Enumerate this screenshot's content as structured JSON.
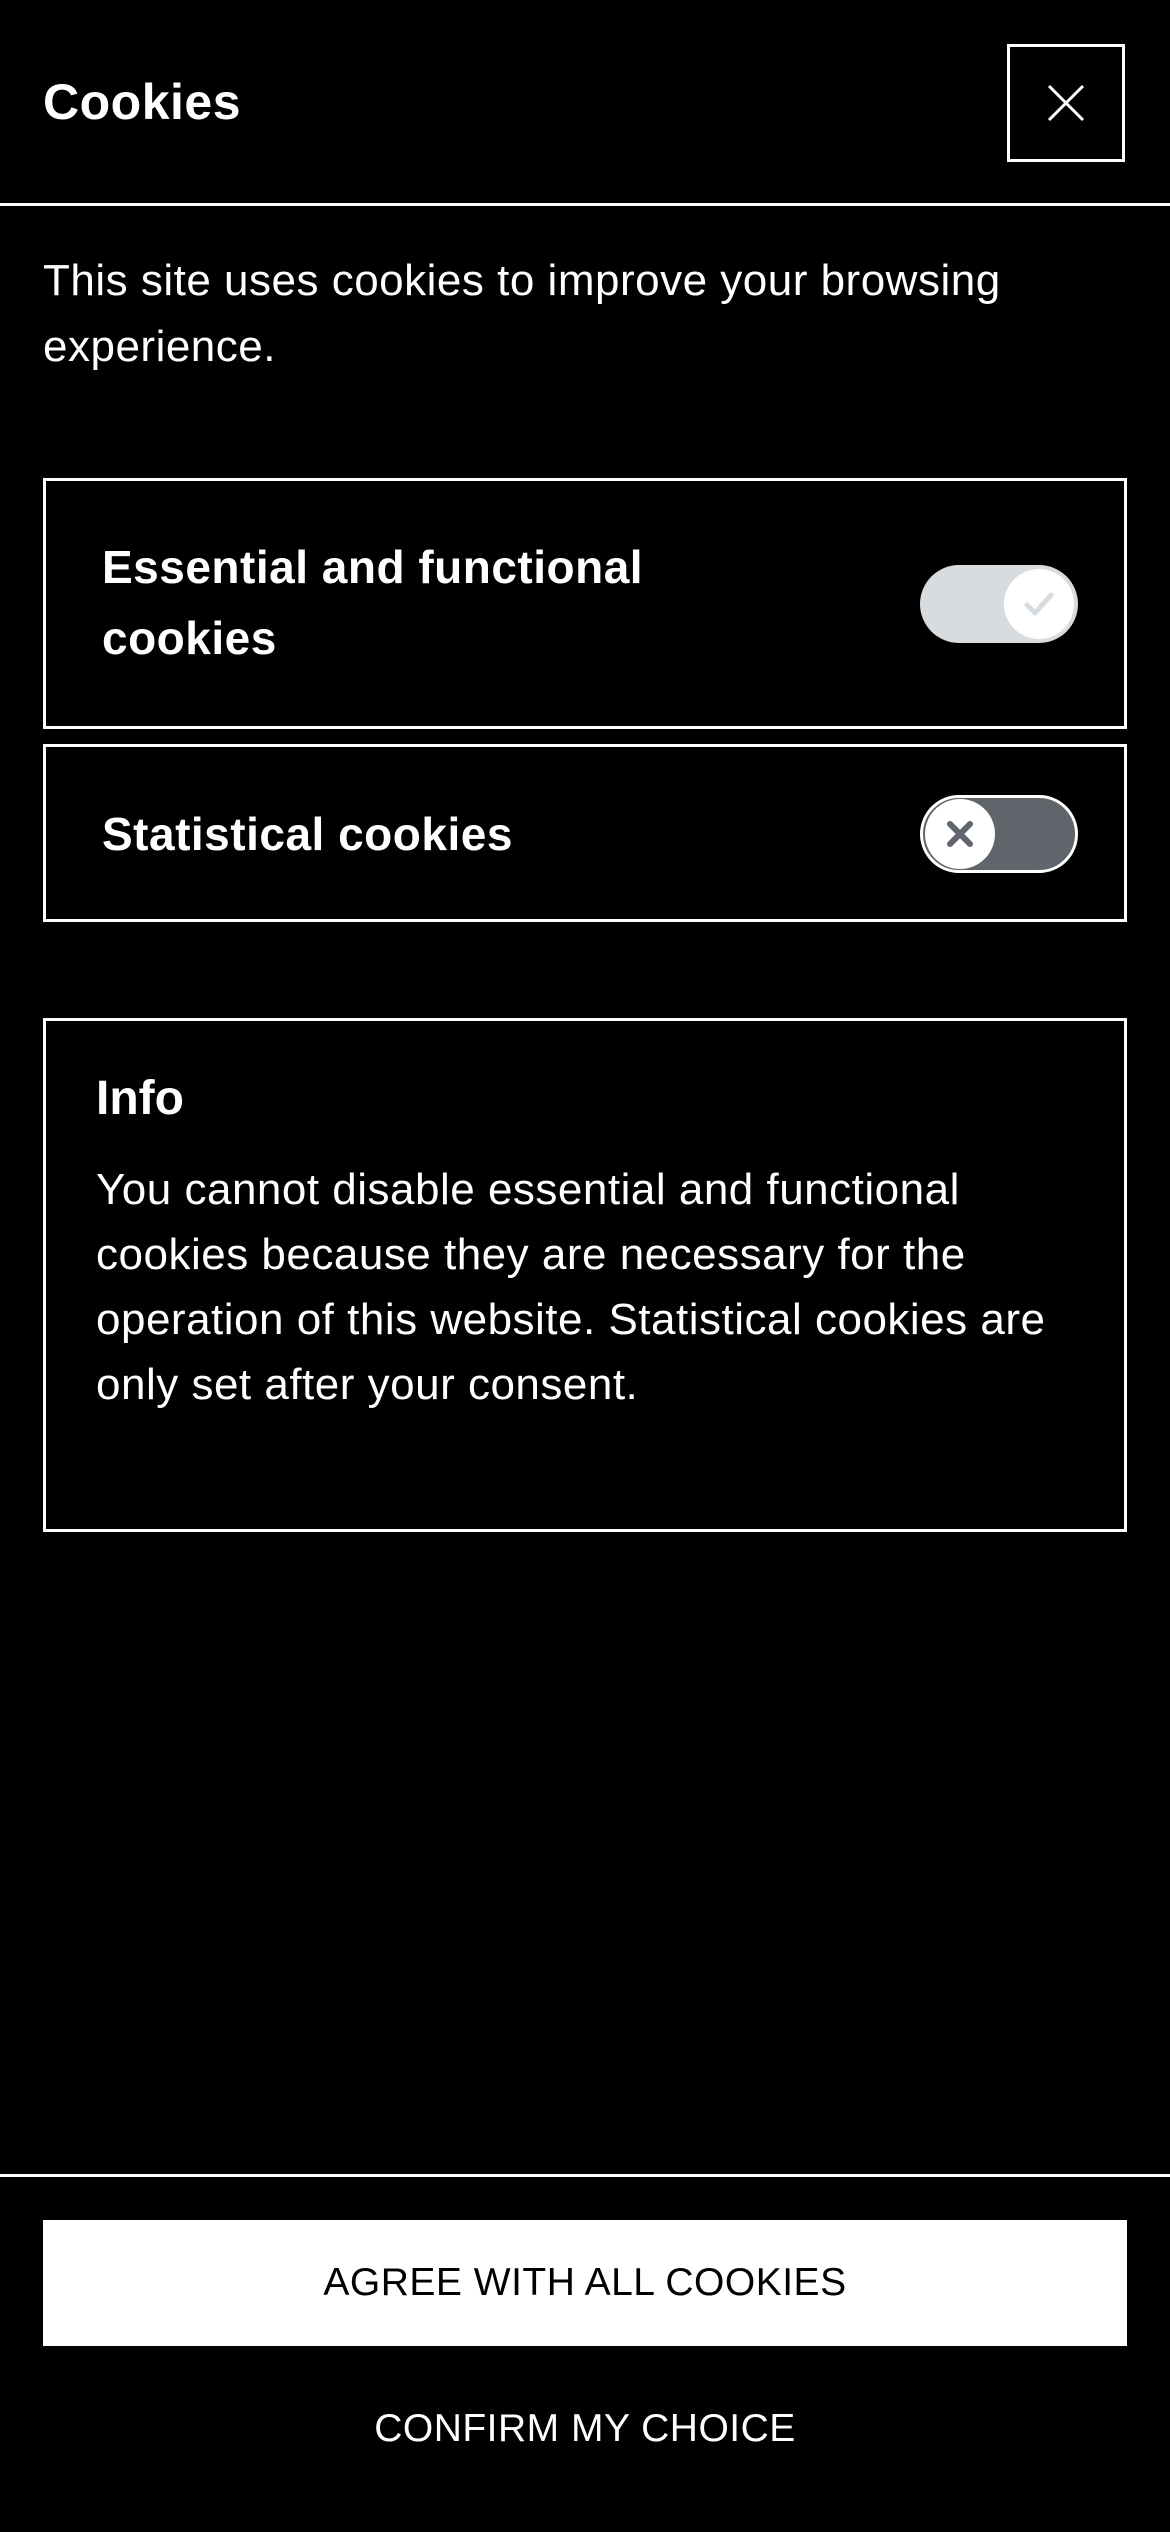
{
  "colors": {
    "background": "#000000",
    "foreground": "#ffffff",
    "toggle_on_track": "#d6dcdf",
    "toggle_off_track": "#5f656b",
    "toggle_icon": "#5f656b"
  },
  "header": {
    "title": "Cookies",
    "close_icon": "close-icon"
  },
  "intro": "This site uses cookies to improve your browsing experience.",
  "cookies": [
    {
      "label": "Essential and functional cookies",
      "enabled": true,
      "locked": true,
      "icon": "check-icon"
    },
    {
      "label": "Statistical cookies",
      "enabled": false,
      "locked": false,
      "icon": "x-icon"
    }
  ],
  "info": {
    "title": "Info",
    "text": "You cannot disable essential and functional cookies because they are necessary for the operation of this website. Statistical cookies are only set after your consent."
  },
  "footer": {
    "agree_label": "AGREE WITH ALL COOKIES",
    "confirm_label": "CONFIRM MY CHOICE"
  }
}
